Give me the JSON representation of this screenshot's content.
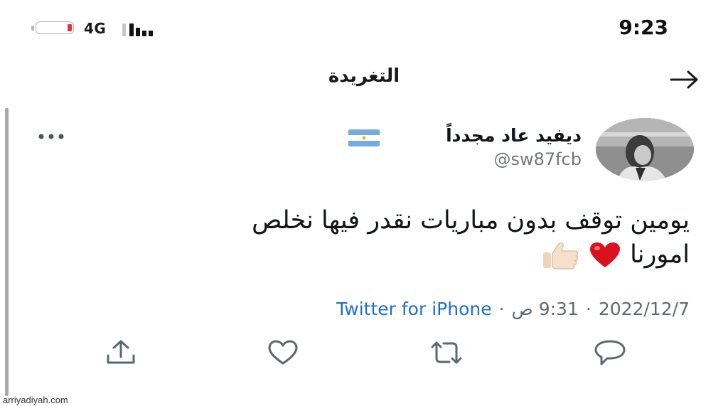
{
  "status_bar": {
    "network": "4G",
    "time": "9:23",
    "battery_level": 0.12
  },
  "header": {
    "title": "التغريدة"
  },
  "tweet": {
    "user_name": "ديفيد عاد مجدداً",
    "handle": "@sw87fcb",
    "text_line1": "يومين توقف بدون مباريات نقدر فيها نخلص",
    "text_line2": "امورنا",
    "date": "2022/12/7",
    "time": "9:31 ص",
    "source": "Twitter for iPhone"
  },
  "icons": {
    "back": "arrow-right-icon",
    "more": "more-dots-icon",
    "share": "share-icon",
    "like": "heart-icon",
    "retweet": "retweet-icon",
    "reply": "reply-icon",
    "flag": "argentina-flag-icon",
    "heart_emoji": "red-heart-emoji",
    "thumbs_emoji": "thumbs-up-emoji"
  },
  "colors": {
    "link_blue": "#1d6fcf",
    "battery_red": "#e5322d",
    "heart_red": "#d9121f"
  },
  "watermark": "arriyadiyah.com"
}
